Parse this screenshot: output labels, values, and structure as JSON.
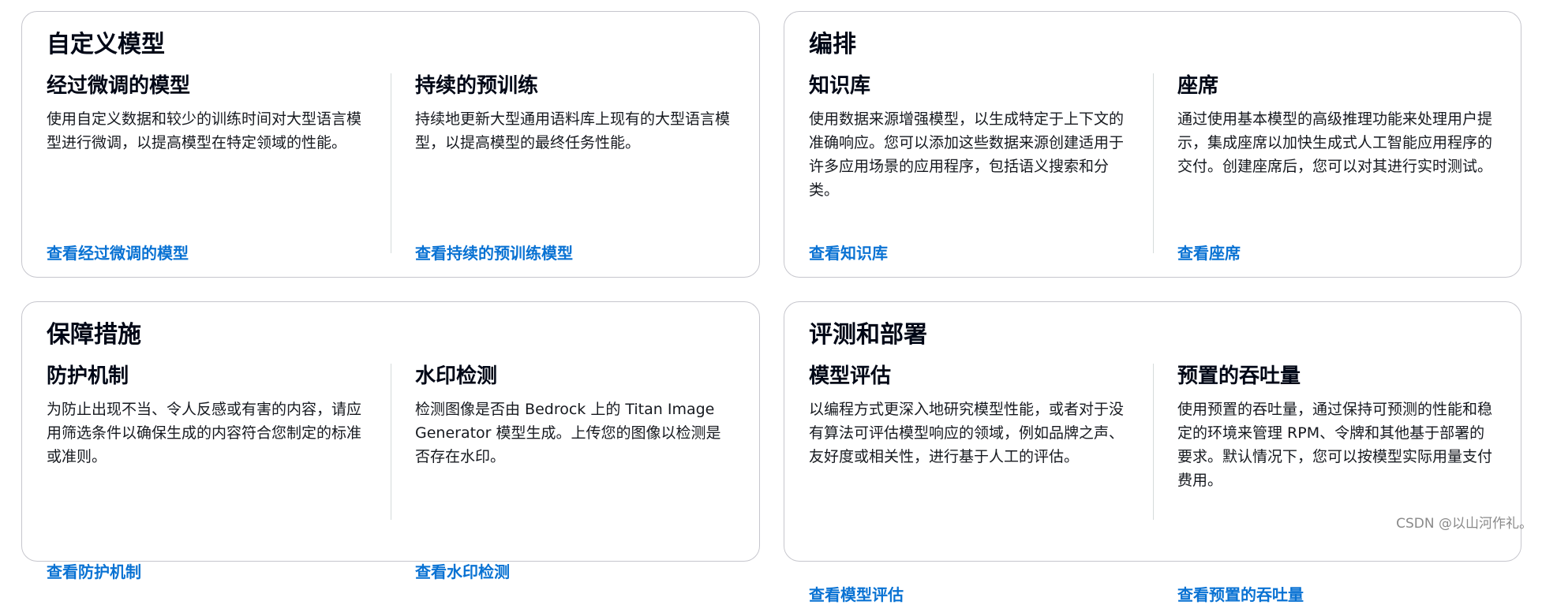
{
  "cards": [
    {
      "title": "自定义模型",
      "features": [
        {
          "title": "经过微调的模型",
          "description": "使用自定义数据和较少的训练时间对大型语言模型进行微调，以提高模型在特定领域的性能。",
          "link": "查看经过微调的模型"
        },
        {
          "title": "持续的预训练",
          "description": "持续地更新大型通用语料库上现有的大型语言模型，以提高模型的最终任务性能。",
          "link": "查看持续的预训练模型"
        }
      ]
    },
    {
      "title": "编排",
      "features": [
        {
          "title": "知识库",
          "description": "使用数据来源增强模型，以生成特定于上下文的准确响应。您可以添加这些数据来源创建适用于许多应用场景的应用程序，包括语义搜索和分类。",
          "link": "查看知识库"
        },
        {
          "title": "座席",
          "description": "通过使用基本模型的高级推理功能来处理用户提示，集成座席以加快生成式人工智能应用程序的交付。创建座席后，您可以对其进行实时测试。",
          "link": "查看座席"
        }
      ]
    },
    {
      "title": "保障措施",
      "features": [
        {
          "title": "防护机制",
          "description": "为防止出现不当、令人反感或有害的内容，请应用筛选条件以确保生成的内容符合您制定的标准或准则。",
          "link": "查看防护机制"
        },
        {
          "title": "水印检测",
          "description": "检测图像是否由 Bedrock 上的 Titan Image Generator 模型生成。上传您的图像以检测是否存在水印。",
          "link": "查看水印检测"
        }
      ]
    },
    {
      "title": "评测和部署",
      "features": [
        {
          "title": "模型评估",
          "description": "以编程方式更深入地研究模型性能，或者对于没有算法可评估模型响应的领域，例如品牌之声、友好度或相关性，进行基于人工的评估。",
          "link": "查看模型评估"
        },
        {
          "title": "预置的吞吐量",
          "description": "使用预置的吞吐量，通过保持可预测的性能和稳定的环境来管理 RPM、令牌和其他基于部署的要求。默认情况下，您可以按模型实际用量支付费用。",
          "link": "查看预置的吞吐量"
        }
      ]
    }
  ],
  "watermark": "CSDN @以山河作礼。",
  "colors": {
    "link": "#0972d3",
    "title": "#000716",
    "text": "#16191f",
    "card_border": "#c6c6cd",
    "divider": "#d5dbdb"
  }
}
